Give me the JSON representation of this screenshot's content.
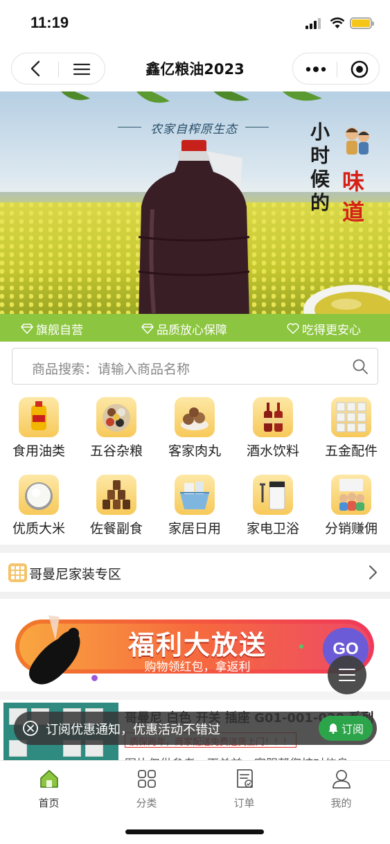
{
  "status_bar": {
    "time": "11:19"
  },
  "navbar": {
    "title": "鑫亿粮油2023"
  },
  "banner": {
    "slogan": "农家自榨原生态",
    "side_text_black": "小时候的",
    "side_text_red": "味道"
  },
  "trust_strip": {
    "items": [
      {
        "label": "旗舰自营",
        "icon": "diamond-icon"
      },
      {
        "label": "品质放心保障",
        "icon": "diamond-icon"
      },
      {
        "label": "吃得更安心",
        "icon": "heart-icon"
      }
    ]
  },
  "search": {
    "placeholder": "商品搜索：请输入商品名称"
  },
  "categories": [
    {
      "label": "食用油类",
      "icon": "oil-bottle-icon"
    },
    {
      "label": "五谷杂粮",
      "icon": "grains-icon"
    },
    {
      "label": "客家肉丸",
      "icon": "meatball-icon"
    },
    {
      "label": "酒水饮料",
      "icon": "wine-icon"
    },
    {
      "label": "五金配件",
      "icon": "switch-panel-icon"
    },
    {
      "label": "优质大米",
      "icon": "rice-icon"
    },
    {
      "label": "佐餐副食",
      "icon": "jars-icon"
    },
    {
      "label": "家居日用",
      "icon": "basket-icon"
    },
    {
      "label": "家电卫浴",
      "icon": "water-purifier-icon"
    },
    {
      "label": "分销赚佣",
      "icon": "people-icon"
    }
  ],
  "zone": {
    "label": "哥曼尼家装专区"
  },
  "promo": {
    "title": "福利大放送",
    "subtitle": "购物领红包，拿返利",
    "go_label": "GO"
  },
  "product": {
    "name": "哥曼尼 白色 开关 插座 G01-001-020 系列",
    "tag": "质保两年，商家配送免费送货上门！！！",
    "desc": "图片仅供参考，下单前，客服帮您核对信息..."
  },
  "subscribe_bar": {
    "message": "订阅优惠通知，优惠活动不错过",
    "button_label": "订阅"
  },
  "tabbar": {
    "tabs": [
      {
        "label": "首页",
        "icon": "home-icon"
      },
      {
        "label": "分类",
        "icon": "grid-icon"
      },
      {
        "label": "订单",
        "icon": "order-icon"
      },
      {
        "label": "我的",
        "icon": "user-icon"
      }
    ]
  },
  "colors": {
    "accent_green": "#8cc53f",
    "subscribe_green": "#2ca44a",
    "tag_red": "#e0312a",
    "promo_purple": "#6b5bd6"
  }
}
